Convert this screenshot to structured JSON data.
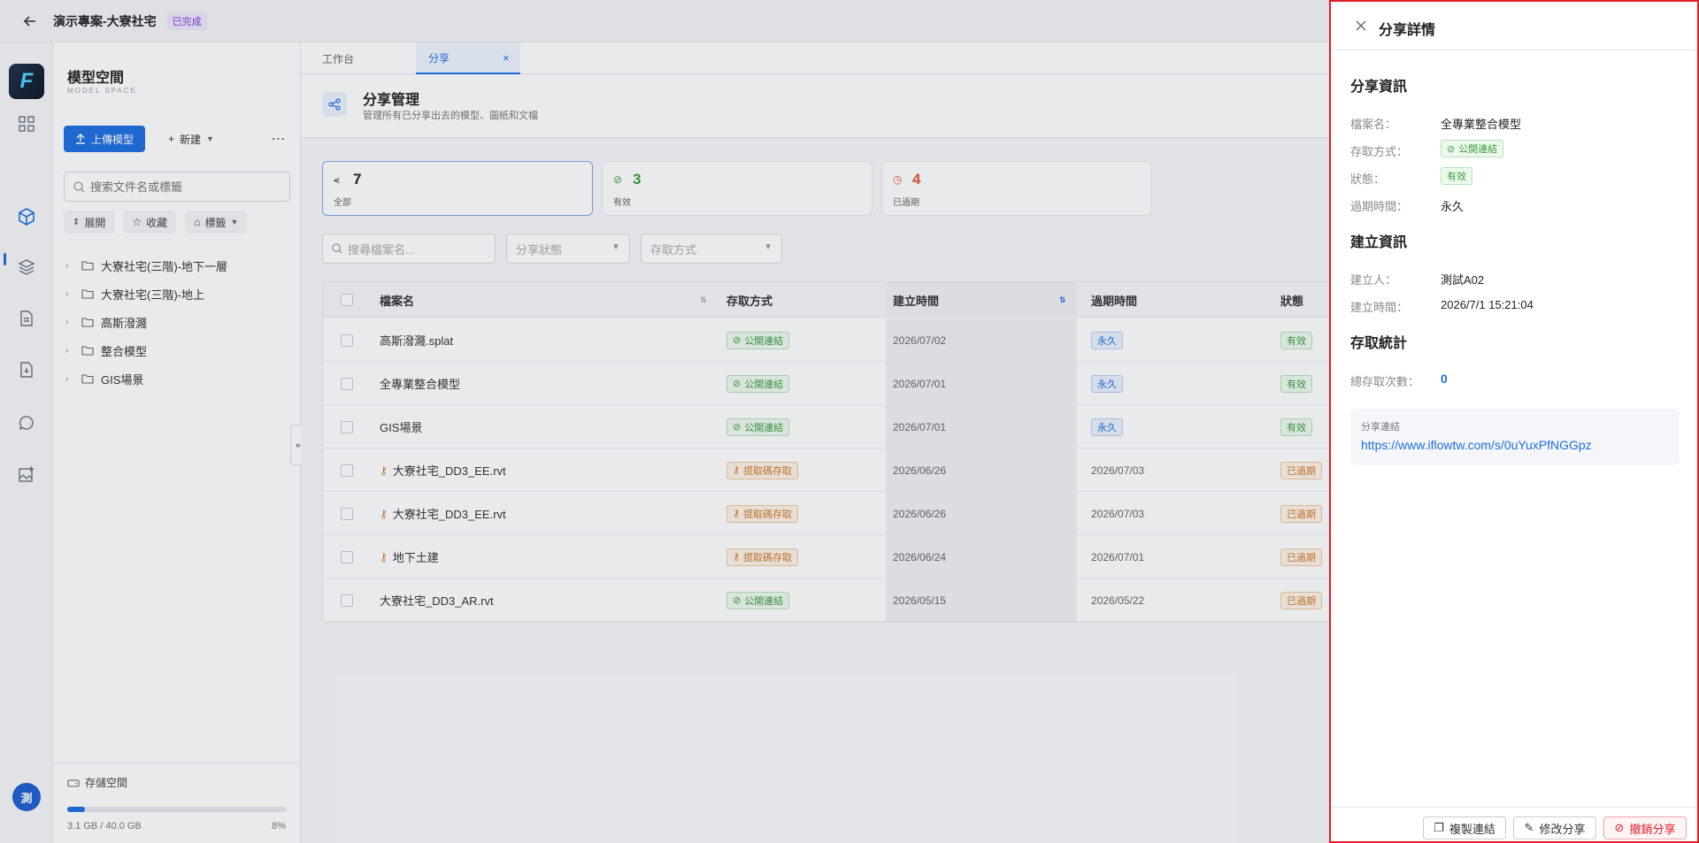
{
  "topbar": {
    "project_title": "演示專案-大寮社宅",
    "status_badge": "已完成"
  },
  "rail": {
    "avatar_text": "測"
  },
  "model_panel": {
    "title": "模型空間",
    "subtitle": "MODEL SPACE",
    "upload_label": "上傳模型",
    "new_label": "新建",
    "search_placeholder": "搜索文件名或標籤",
    "filters": {
      "expand": "展開",
      "favorite": "收藏",
      "tags": "標籤"
    },
    "tree": [
      "大寮社宅(三階)-地下一層",
      "大寮社宅(三階)-地上",
      "高斯潑濺",
      "整合模型",
      "GIS場景"
    ],
    "storage_label": "存儲空間",
    "storage_used": "3.1 GB / 40.0 GB",
    "storage_percent_label": "8%",
    "storage_fraction": 0.08
  },
  "tabs": {
    "workbench": "工作台",
    "share": "分享"
  },
  "page_header": {
    "title": "分享管理",
    "desc": "管理所有已分享出去的模型、圖紙和文檔"
  },
  "stats": [
    {
      "value": "7",
      "label": "全部",
      "color": "#222222"
    },
    {
      "value": "3",
      "label": "有效",
      "color": "#3e9b3e"
    },
    {
      "value": "4",
      "label": "已過期",
      "color": "#e5533a"
    }
  ],
  "filters": {
    "search_placeholder": "搜尋檔案名...",
    "status_placeholder": "分享狀態",
    "access_placeholder": "存取方式"
  },
  "table": {
    "headers": {
      "name": "檔案名",
      "access": "存取方式",
      "created": "建立時間",
      "expires": "過期時間",
      "status": "狀態"
    },
    "rows": [
      {
        "name": "高斯潑濺.splat",
        "access": "公開連結",
        "created": "2026/07/02",
        "expires": "永久",
        "status": "有效"
      },
      {
        "name": "全專業整合模型",
        "access": "公開連結",
        "created": "2026/07/01",
        "expires": "永久",
        "status": "有效"
      },
      {
        "name": "GIS場景",
        "access": "公開連結",
        "created": "2026/07/01",
        "expires": "永久",
        "status": "有效"
      },
      {
        "name": "大寮社宅_DD3_EE.rvt",
        "access": "提取碼存取",
        "created": "2026/06/26",
        "expires": "2026/07/03",
        "status": "已過期"
      },
      {
        "name": "大寮社宅_DD3_EE.rvt",
        "access": "提取碼存取",
        "created": "2026/06/26",
        "expires": "2026/07/03",
        "status": "已過期"
      },
      {
        "name": "地下土建",
        "access": "提取碼存取",
        "created": "2026/06/24",
        "expires": "2026/07/01",
        "status": "已過期"
      },
      {
        "name": "大寮社宅_DD3_AR.rvt",
        "access": "公開連結",
        "created": "2026/05/15",
        "expires": "2026/05/22",
        "status": "已過期"
      }
    ]
  },
  "drawer": {
    "title": "分享詳情",
    "share_info_heading": "分享資訊",
    "file_name_label": "檔案名：",
    "file_name_value": "全專業整合模型",
    "access_label": "存取方式：",
    "access_value": "公開連結",
    "status_label": "狀態：",
    "status_value": "有效",
    "expire_label": "過期時間：",
    "expire_value": "永久",
    "create_info_heading": "建立資訊",
    "creator_label": "建立人：",
    "creator_value": "測試A02",
    "created_label": "建立時間：",
    "created_value": "2026/7/1 15:21:04",
    "stats_heading": "存取統計",
    "total_label": "總存取次數：",
    "total_value": "0",
    "link_title": "分享連結",
    "link_url": "https://www.iflowtw.com/s/0uYuxPfNGGpz",
    "copy_label": "複製連結",
    "edit_label": "修改分享",
    "revoke_label": "撤銷分享"
  }
}
